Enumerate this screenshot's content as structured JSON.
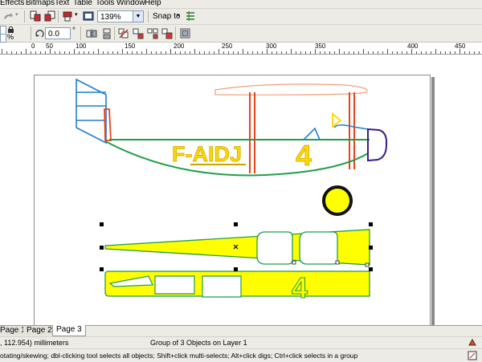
{
  "menu": {
    "items": [
      "Effects",
      "Bitmaps",
      "Text",
      "Table",
      "Tools",
      "Window",
      "Help"
    ]
  },
  "toolbar": {
    "zoom": "139%",
    "snap_label": "Snap to",
    "angle_value": "0.0",
    "angle_unit": "°",
    "percent_a": "%",
    "percent_b": "%"
  },
  "ruler": {
    "labels": [
      "0",
      "50",
      "100",
      "150",
      "200",
      "250",
      "300",
      "350",
      "400",
      "450"
    ]
  },
  "drawing": {
    "registration_text": "F-AIDJ",
    "fin_number": "4",
    "part_number": "4",
    "colors": {
      "yellow": "#ffff00",
      "text_fill": "#ffd800",
      "strut": "#e8431a",
      "outline_green": "#1f9e47",
      "tail_blue": "#1f7fd0",
      "nose_purple": "#3b1c8c",
      "wing_orange": "#f2a07a"
    }
  },
  "pages": {
    "tabs": [
      "Page 1",
      "Page 2",
      "Page 3"
    ],
    "active": 2
  },
  "status": {
    "coords": ", 112.954) millimeters",
    "selection": "Group of 3 Objects on Layer 1",
    "hint": "otating/skewing; dbl-clicking tool selects all objects; Shift+click multi-selects; Alt+click digs; Ctrl+click selects in a group"
  }
}
